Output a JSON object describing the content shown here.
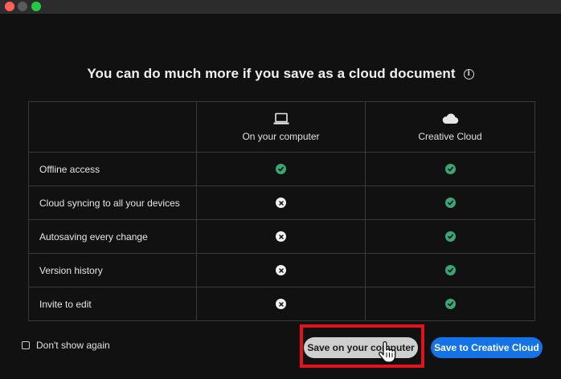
{
  "window": {
    "controls": [
      "close",
      "minimize",
      "zoom"
    ]
  },
  "dialog": {
    "title": "You can do much more if you save as a cloud document",
    "info_icon": "info-icon",
    "columns": [
      {
        "label": "On your computer",
        "icon": "laptop-icon"
      },
      {
        "label": "Creative Cloud",
        "icon": "cloud-icon"
      }
    ],
    "rows": [
      {
        "feature": "Offline access",
        "computer": "check",
        "cloud": "check"
      },
      {
        "feature": "Cloud syncing to all your devices",
        "computer": "cross",
        "cloud": "check"
      },
      {
        "feature": "Autosaving every change",
        "computer": "cross",
        "cloud": "check"
      },
      {
        "feature": "Version history",
        "computer": "cross",
        "cloud": "check"
      },
      {
        "feature": "Invite to edit",
        "computer": "cross",
        "cloud": "check"
      }
    ]
  },
  "footer": {
    "dont_show_label": "Don't show again",
    "dont_show_checked": false,
    "save_computer_label": "Save on your computer",
    "save_cloud_label": "Save to Creative Cloud"
  },
  "colors": {
    "background": "#111111",
    "check": "#38a675",
    "primary_button": "#1473e6",
    "secondary_button": "#cfcfcf",
    "highlight": "#e3131b"
  }
}
